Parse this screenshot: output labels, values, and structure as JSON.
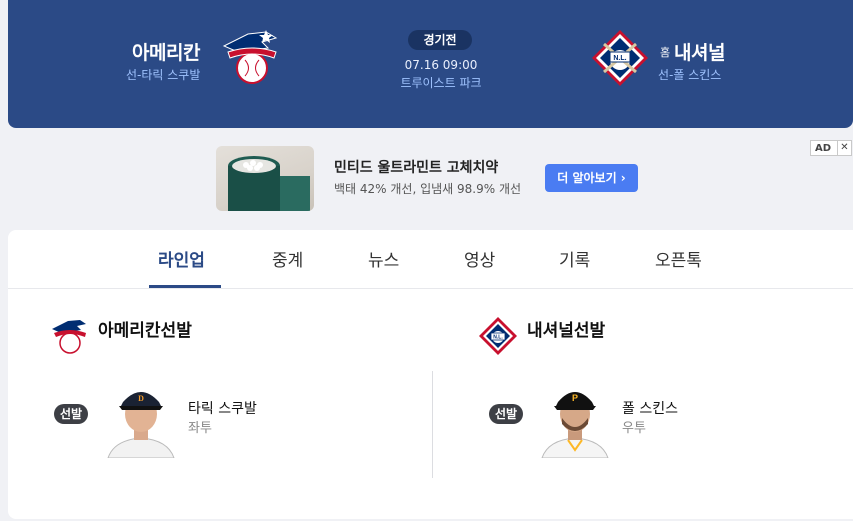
{
  "header": {
    "away": {
      "name": "아메리칸",
      "pitcher": "선-타릭 스쿠발",
      "logo": "american-league-logo"
    },
    "home": {
      "tag": "홈",
      "name": "내셔널",
      "pitcher": "선-폴 스킨스",
      "logo": "national-league-logo"
    },
    "status": "경기전",
    "time": "07.16 09:00",
    "stadium": "트루이스트 파크"
  },
  "ad": {
    "title": "민티드 울트라민트 고체치약",
    "description": "백태 42% 개선, 입냄새 98.9% 개선",
    "cta": "더 알아보기 ›",
    "badge": "AD",
    "close": "✕"
  },
  "tabs": [
    {
      "label": "라인업",
      "active": true
    },
    {
      "label": "중계"
    },
    {
      "label": "뉴스"
    },
    {
      "label": "영상"
    },
    {
      "label": "기록"
    },
    {
      "label": "오픈톡"
    }
  ],
  "lineup": {
    "away": {
      "heading": "아메리칸선발",
      "tag": "선발",
      "player": "타릭 스쿠발",
      "hand": "좌투"
    },
    "home": {
      "heading": "내셔널선발",
      "tag": "선발",
      "player": "폴 스킨스",
      "hand": "우투"
    }
  },
  "colors": {
    "header_bg": "#2b4a86",
    "accent": "#2b4a86",
    "cta": "#4a7cf2",
    "sub_text": "#9fc3ff"
  }
}
